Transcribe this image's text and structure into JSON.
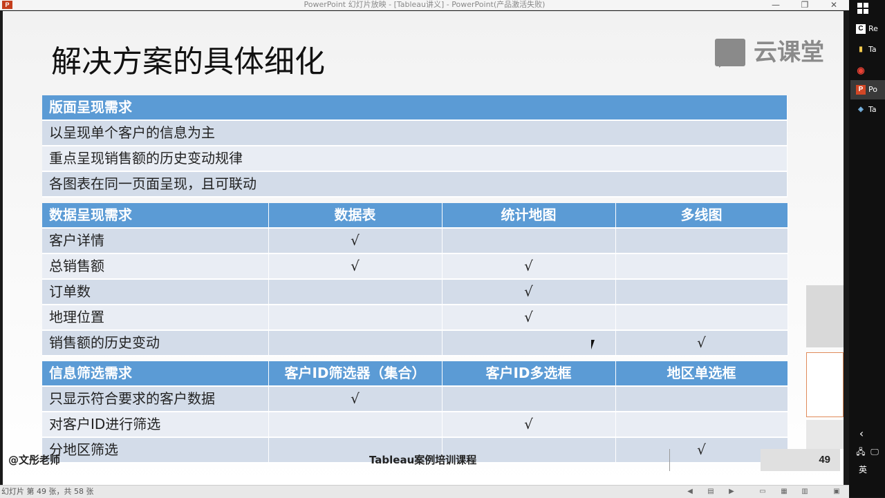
{
  "window": {
    "title": "PowerPoint 幻灯片放映 - [Tableau讲义] - PowerPoint(产品激活失败)",
    "app_icon": "P",
    "controls": {
      "minimize": "—",
      "restore": "❐",
      "close": "✕"
    }
  },
  "slide": {
    "title": "解决方案的具体细化",
    "logo_text": "云课堂",
    "check": "√",
    "layout_table": {
      "header": "版面呈现需求",
      "rows": [
        "以呈现单个客户的信息为主",
        "重点呈现销售额的历史变动规律",
        "各图表在同一页面呈现，且可联动"
      ]
    },
    "data_table": {
      "headers": [
        "数据呈现需求",
        "数据表",
        "统计地图",
        "多线图"
      ],
      "rows": [
        {
          "label": "客户详情",
          "cells": [
            "√",
            "",
            ""
          ]
        },
        {
          "label": "总销售额",
          "cells": [
            "√",
            "√",
            ""
          ]
        },
        {
          "label": "订单数",
          "cells": [
            "",
            "√",
            ""
          ]
        },
        {
          "label": "地理位置",
          "cells": [
            "",
            "√",
            ""
          ]
        },
        {
          "label": "销售额的历史变动",
          "cells": [
            "",
            "",
            "√"
          ]
        }
      ]
    },
    "filter_table": {
      "headers": [
        "信息筛选需求",
        "客户ID筛选器（集合）",
        "客户ID多选框",
        "地区单选框"
      ],
      "rows": [
        {
          "label": "只显示符合要求的客户数据",
          "cells": [
            "√",
            "",
            ""
          ]
        },
        {
          "label": "对客户ID进行筛选",
          "cells": [
            "",
            "√",
            ""
          ]
        },
        {
          "label": "分地区筛选",
          "cells": [
            "",
            "",
            "√"
          ]
        }
      ]
    },
    "footer": {
      "author": "@文彤老师",
      "course": "Tableau案例培训课程",
      "page_number": "49"
    }
  },
  "statusbar": {
    "text": "幻灯片 第 49 张，共 58 张"
  },
  "taskbar": {
    "items": [
      {
        "icon": "C",
        "label": "Re"
      },
      {
        "icon": "▮",
        "label": "Ta"
      },
      {
        "icon": "◉",
        "label": ""
      },
      {
        "icon": "P",
        "label": "Po"
      },
      {
        "icon": "◈",
        "label": "Ta"
      }
    ],
    "chevron": "‹",
    "lang": "英"
  },
  "colors": {
    "header_blue": "#5b9bd5",
    "row_odd": "#d3dce9",
    "row_even": "#e9edf4"
  }
}
